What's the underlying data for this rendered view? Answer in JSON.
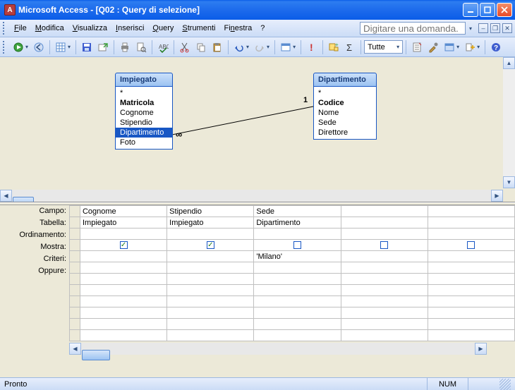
{
  "window": {
    "title": "Microsoft Access - [Q02 : Query di selezione]"
  },
  "menu": {
    "file": "File",
    "modifica": "Modifica",
    "visualizza": "Visualizza",
    "inserisci": "Inserisci",
    "query": "Query",
    "strumenti": "Strumenti",
    "finestra": "Finestra",
    "help": "?",
    "help_box_placeholder": "Digitare una domanda."
  },
  "toolbar": {
    "combo_value": "Tutte"
  },
  "tables": {
    "impiegato": {
      "title": "Impiegato",
      "fields": [
        "*",
        "Matricola",
        "Cognome",
        "Stipendio",
        "Dipartimento",
        "Foto"
      ],
      "bold_index": 1,
      "selected_index": 4
    },
    "dipartimento": {
      "title": "Dipartimento",
      "fields": [
        "*",
        "Codice",
        "Nome",
        "Sede",
        "Direttore"
      ],
      "bold_index": 1
    }
  },
  "relationship": {
    "left_symbol": "∞",
    "right_symbol": "1"
  },
  "grid": {
    "labels": {
      "campo": "Campo:",
      "tabella": "Tabella:",
      "ordinamento": "Ordinamento:",
      "mostra": "Mostra:",
      "criteri": "Criteri:",
      "oppure": "Oppure:"
    },
    "columns": [
      {
        "campo": "Cognome",
        "tabella": "Impiegato",
        "mostra": true,
        "criteri": ""
      },
      {
        "campo": "Stipendio",
        "tabella": "Impiegato",
        "mostra": true,
        "criteri": ""
      },
      {
        "campo": "Sede",
        "tabella": "Dipartimento",
        "mostra": false,
        "criteri": "'Milano'"
      },
      {
        "campo": "",
        "tabella": "",
        "mostra": false,
        "criteri": ""
      },
      {
        "campo": "",
        "tabella": "",
        "mostra": false,
        "criteri": ""
      }
    ]
  },
  "status": {
    "ready": "Pronto",
    "num": "NUM"
  }
}
